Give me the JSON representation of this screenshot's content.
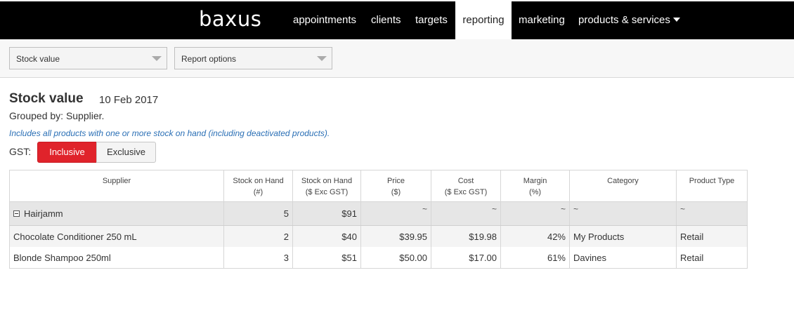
{
  "app": {
    "logo": "baxus"
  },
  "nav": {
    "appointments": "appointments",
    "clients": "clients",
    "targets": "targets",
    "reporting": "reporting",
    "marketing": "marketing",
    "products": "products & services"
  },
  "toolbar": {
    "report_select": "Stock value",
    "options_select": "Report options"
  },
  "report": {
    "title": "Stock value",
    "date": "10 Feb 2017",
    "grouped_by": "Grouped by: Supplier.",
    "note": "Includes all products with one or more stock on hand (including deactivated products).",
    "gst_label": "GST:",
    "gst_inclusive": "Inclusive",
    "gst_exclusive": "Exclusive"
  },
  "table": {
    "headers": [
      {
        "line1": "Supplier",
        "line2": ""
      },
      {
        "line1": "Stock on Hand",
        "line2": "(#)"
      },
      {
        "line1": "Stock on Hand",
        "line2": "($ Exc GST)"
      },
      {
        "line1": "Price",
        "line2": "($)"
      },
      {
        "line1": "Cost",
        "line2": "($ Exc GST)"
      },
      {
        "line1": "Margin",
        "line2": "(%)"
      },
      {
        "line1": "Category",
        "line2": ""
      },
      {
        "line1": "Product Type",
        "line2": ""
      }
    ],
    "group": {
      "name": "Hairjamm",
      "stock_qty": "5",
      "stock_value": "$91",
      "price": "~",
      "cost": "~",
      "margin": "~",
      "category": "~",
      "type": "~"
    },
    "rows": [
      {
        "name": "Chocolate Conditioner 250 mL",
        "stock_qty": "2",
        "stock_value": "$40",
        "price": "$39.95",
        "cost": "$19.98",
        "margin": "42%",
        "category": "My Products",
        "type": "Retail"
      },
      {
        "name": "Blonde Shampoo 250ml",
        "stock_qty": "3",
        "stock_value": "$51",
        "price": "$50.00",
        "cost": "$17.00",
        "margin": "61%",
        "category": "Davines",
        "type": "Retail"
      }
    ]
  },
  "colors": {
    "accent": "#e0232b",
    "topbar": "#000000",
    "note": "#2a6fb5"
  }
}
